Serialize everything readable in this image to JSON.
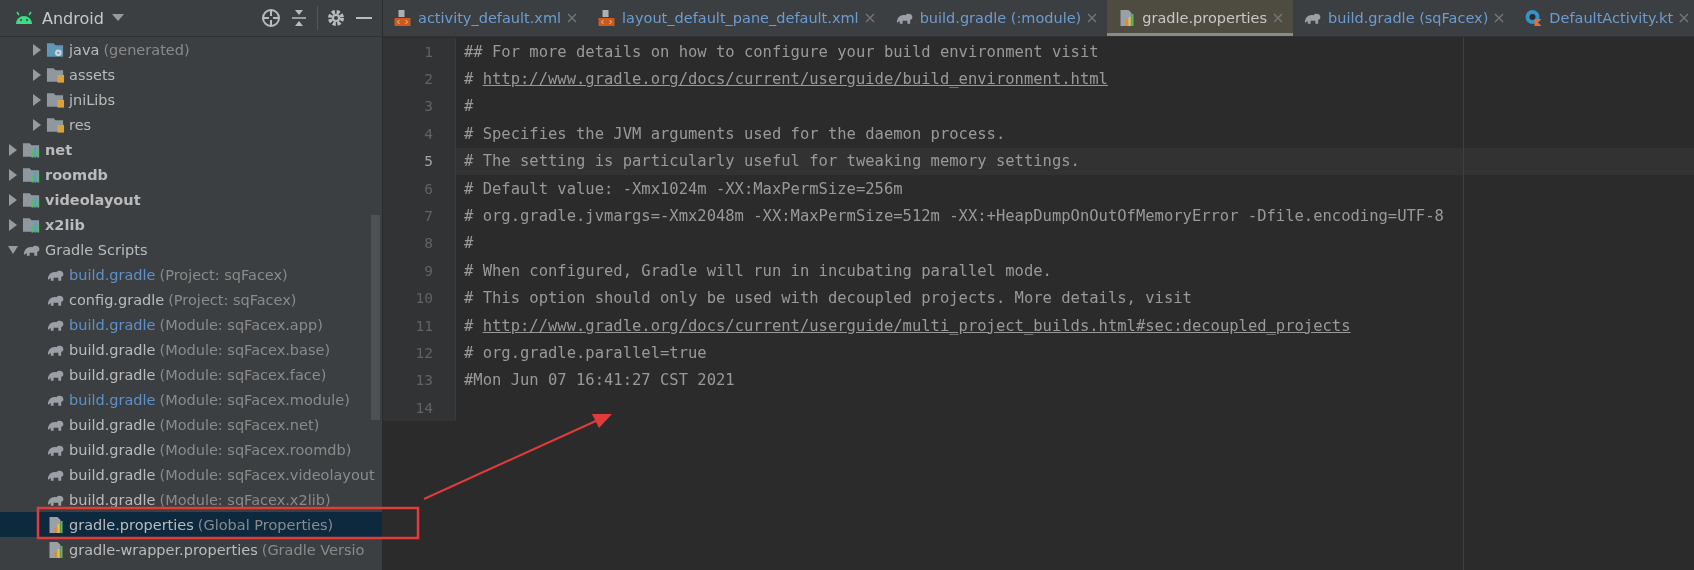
{
  "sidebar": {
    "view": "Android",
    "continued_children": [
      {
        "label": "java",
        "detail": "(generated)",
        "kind": "generated-folder",
        "expanded": false,
        "modified": false,
        "selected": false
      },
      {
        "label": "assets",
        "kind": "resource-folder",
        "expanded": false,
        "modified": false,
        "selected": false
      },
      {
        "label": "jniLibs",
        "kind": "resource-folder",
        "expanded": false,
        "modified": false,
        "selected": false
      },
      {
        "label": "res",
        "kind": "resource-folder",
        "expanded": false,
        "modified": false,
        "selected": false
      }
    ],
    "tree": [
      {
        "label": "net",
        "kind": "module",
        "expanded": false,
        "modified": false,
        "selected": false
      },
      {
        "label": "roomdb",
        "kind": "module",
        "expanded": false,
        "modified": false,
        "selected": false
      },
      {
        "label": "videolayout",
        "kind": "module",
        "expanded": false,
        "modified": false,
        "selected": false
      },
      {
        "label": "x2lib",
        "kind": "module",
        "expanded": false,
        "modified": false,
        "selected": false
      },
      {
        "label": "Gradle Scripts",
        "kind": "gradle-root",
        "expanded": true,
        "modified": false,
        "selected": false,
        "children": [
          {
            "label": "build.gradle",
            "detail": "(Project: sqFacex)",
            "kind": "gradle",
            "modified": true,
            "selected": false
          },
          {
            "label": "config.gradle",
            "detail": "(Project: sqFacex)",
            "kind": "gradle",
            "modified": false,
            "selected": false
          },
          {
            "label": "build.gradle",
            "detail": "(Module: sqFacex.app)",
            "kind": "gradle",
            "modified": true,
            "selected": false
          },
          {
            "label": "build.gradle",
            "detail": "(Module: sqFacex.base)",
            "kind": "gradle",
            "modified": false,
            "selected": false
          },
          {
            "label": "build.gradle",
            "detail": "(Module: sqFacex.face)",
            "kind": "gradle",
            "modified": false,
            "selected": false
          },
          {
            "label": "build.gradle",
            "detail": "(Module: sqFacex.module)",
            "kind": "gradle",
            "modified": true,
            "selected": false
          },
          {
            "label": "build.gradle",
            "detail": "(Module: sqFacex.net)",
            "kind": "gradle",
            "modified": false,
            "selected": false
          },
          {
            "label": "build.gradle",
            "detail": "(Module: sqFacex.roomdb)",
            "kind": "gradle",
            "modified": false,
            "selected": false
          },
          {
            "label": "build.gradle",
            "detail": "(Module: sqFacex.videolayout",
            "kind": "gradle",
            "modified": false,
            "selected": false
          },
          {
            "label": "build.gradle",
            "detail": "(Module: sqFacex.x2lib)",
            "kind": "gradle",
            "modified": false,
            "selected": false
          },
          {
            "label": "gradle.properties",
            "detail": "(Global Properties)",
            "kind": "properties",
            "modified": false,
            "selected": true
          },
          {
            "label": "gradle-wrapper.properties",
            "detail": "(Gradle Versio",
            "kind": "properties",
            "modified": false,
            "selected": false
          }
        ]
      }
    ]
  },
  "tabs": [
    {
      "label": "activity_default.xml",
      "kind": "xml",
      "selected": false
    },
    {
      "label": "layout_default_pane_default.xml",
      "kind": "xml",
      "selected": false
    },
    {
      "label": "build.gradle (:module)",
      "kind": "gradle",
      "selected": false
    },
    {
      "label": "gradle.properties",
      "kind": "properties",
      "selected": true
    },
    {
      "label": "build.gradle (sqFacex)",
      "kind": "gradle",
      "selected": false
    },
    {
      "label": "DefaultActivity.kt",
      "kind": "kotlin",
      "selected": false
    }
  ],
  "editor": {
    "lines": [
      {
        "number": "1",
        "text": "## For more details on how to configure your build environment visit",
        "current": false
      },
      {
        "number": "2",
        "text": "# ",
        "link": "http://www.gradle.org/docs/current/userguide/build_environment.html",
        "current": false
      },
      {
        "number": "3",
        "text": "#",
        "current": false
      },
      {
        "number": "4",
        "text": "# Specifies the JVM arguments used for the daemon process.",
        "current": false
      },
      {
        "number": "5",
        "text": "# The setting is particularly useful for tweaking memory settings.",
        "current": true
      },
      {
        "number": "6",
        "text": "# Default value: -Xmx1024m -XX:MaxPermSize=256m",
        "current": false
      },
      {
        "number": "7",
        "text": "# org.gradle.jvmargs=-Xmx2048m -XX:MaxPermSize=512m -XX:+HeapDumpOnOutOfMemoryError -Dfile.encoding=UTF-8",
        "current": false
      },
      {
        "number": "8",
        "text": "#",
        "current": false
      },
      {
        "number": "9",
        "text": "# When configured, Gradle will run in incubating parallel mode.",
        "current": false
      },
      {
        "number": "10",
        "text": "# This option should only be used with decoupled projects. More details, visit",
        "current": false
      },
      {
        "number": "11",
        "text": "# ",
        "link": "http://www.gradle.org/docs/current/userguide/multi_project_builds.html#sec:decoupled_projects",
        "current": false
      },
      {
        "number": "12",
        "text": "# org.gradle.parallel=true",
        "current": false
      },
      {
        "number": "13",
        "text": "#Mon Jun 07 16:41:27 CST 2021",
        "current": false
      },
      {
        "number": "14",
        "current": false
      }
    ]
  }
}
